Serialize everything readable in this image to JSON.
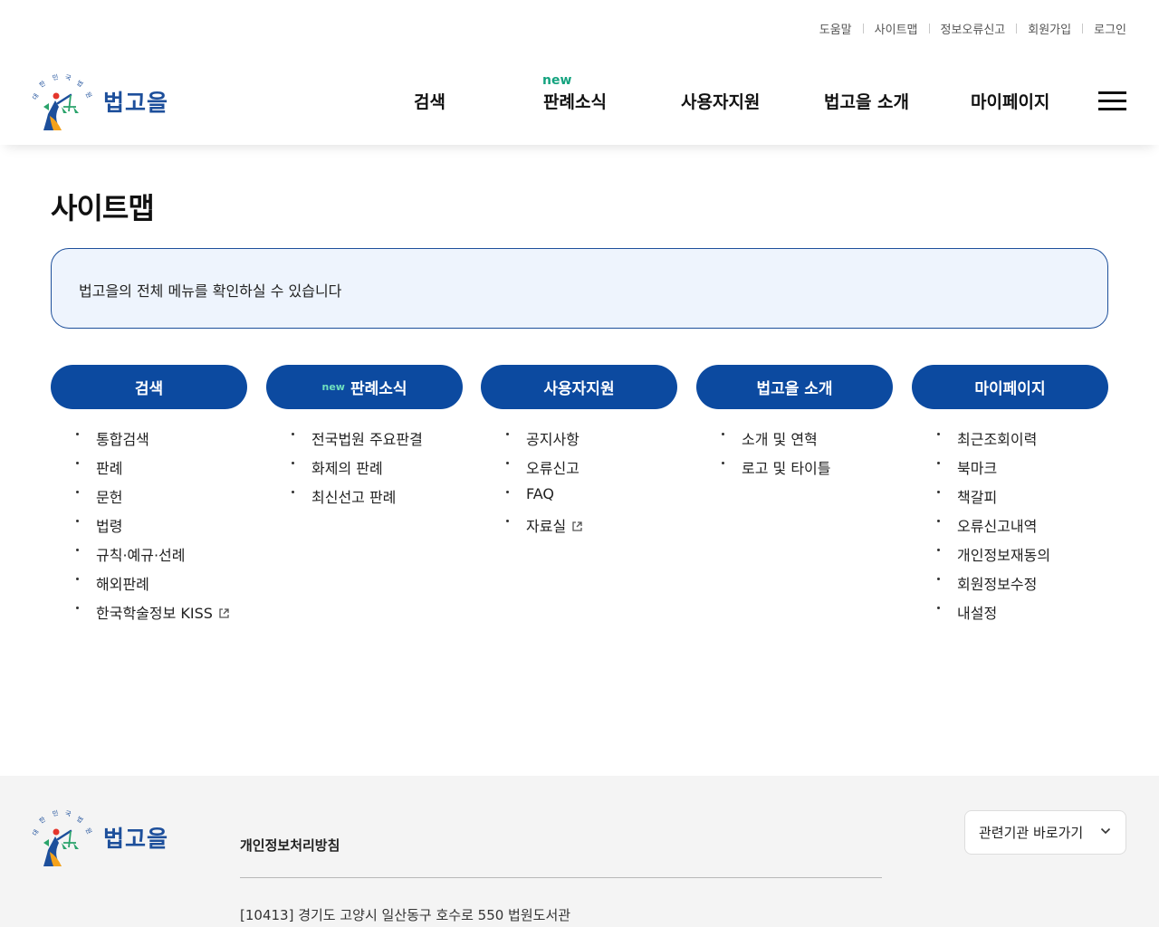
{
  "utility_links": [
    "도움말",
    "사이트맵",
    "정보오류신고",
    "회원가입",
    "로그인"
  ],
  "logo": {
    "name": "법고을",
    "seal_text": "대한민국법원"
  },
  "nav": {
    "items": [
      {
        "label": "검색",
        "badge": ""
      },
      {
        "label": "판례소식",
        "badge": "new"
      },
      {
        "label": "사용자지원",
        "badge": ""
      },
      {
        "label": "법고을 소개",
        "badge": ""
      },
      {
        "label": "마이페이지",
        "badge": ""
      }
    ]
  },
  "page": {
    "title": "사이트맵",
    "description": "법고을의 전체 메뉴를 확인하실 수 있습니다"
  },
  "sitemap": [
    {
      "label": "검색",
      "badge": "",
      "items": [
        {
          "label": "통합검색",
          "external": false
        },
        {
          "label": "판례",
          "external": false
        },
        {
          "label": "문헌",
          "external": false
        },
        {
          "label": "법령",
          "external": false
        },
        {
          "label": "규칙·예규·선례",
          "external": false
        },
        {
          "label": "해외판례",
          "external": false
        },
        {
          "label": "한국학술정보 KISS",
          "external": true
        }
      ]
    },
    {
      "label": "판례소식",
      "badge": "new",
      "items": [
        {
          "label": "전국법원 주요판결",
          "external": false
        },
        {
          "label": "화제의 판례",
          "external": false
        },
        {
          "label": "최신선고 판례",
          "external": false
        }
      ]
    },
    {
      "label": "사용자지원",
      "badge": "",
      "items": [
        {
          "label": "공지사항",
          "external": false
        },
        {
          "label": "오류신고",
          "external": false
        },
        {
          "label": "FAQ",
          "external": false
        },
        {
          "label": "자료실",
          "external": true
        }
      ]
    },
    {
      "label": "법고을 소개",
      "badge": "",
      "items": [
        {
          "label": "소개 및 연혁",
          "external": false
        },
        {
          "label": "로고 및 타이틀",
          "external": false
        }
      ]
    },
    {
      "label": "마이페이지",
      "badge": "",
      "items": [
        {
          "label": "최근조회이력",
          "external": false
        },
        {
          "label": "북마크",
          "external": false
        },
        {
          "label": "책갈피",
          "external": false
        },
        {
          "label": "오류신고내역",
          "external": false
        },
        {
          "label": "개인정보재동의",
          "external": false
        },
        {
          "label": "회원정보수정",
          "external": false
        },
        {
          "label": "내설정",
          "external": false
        }
      ]
    }
  ],
  "footer": {
    "privacy_policy": "개인정보처리방침",
    "address": "[10413] 경기도 고양시 일산동구 호수로 550 법원도서관",
    "related_sites": "관련기관 바로가기"
  },
  "colors": {
    "primary": "#0c4aa0",
    "accent_new": "#14a37f",
    "info_bg": "#eef4fd"
  }
}
